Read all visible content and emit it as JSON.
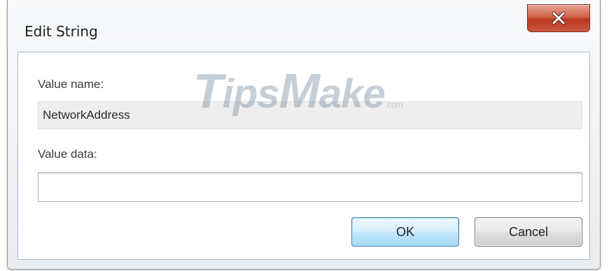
{
  "window": {
    "title": "Edit String",
    "close_icon": "close-x-icon"
  },
  "form": {
    "value_name_label": "Value name:",
    "value_name": "NetworkAddress",
    "value_data_label": "Value data:",
    "value_data": "",
    "value_data_placeholder": ""
  },
  "buttons": {
    "ok_label": "OK",
    "cancel_label": "Cancel"
  },
  "watermark": {
    "letter_t": "T",
    "text_ips": "ips",
    "letter_m": "M",
    "text_ake": "ake",
    "domain": ".com"
  },
  "colors": {
    "close_button": "#c9472c",
    "ok_border": "#3c7fb1",
    "ok_fill": "#bee6fd"
  }
}
